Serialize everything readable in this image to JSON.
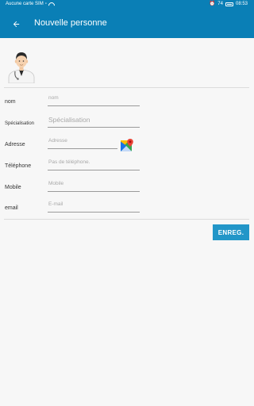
{
  "status_bar": {
    "carrier": "Aucune carte SIM",
    "battery": "74",
    "time": "08:53"
  },
  "app_bar": {
    "title": "Nouvelle personne",
    "back_icon": "arrow-left-icon"
  },
  "avatar_icon": "doctor-avatar-icon",
  "form": {
    "fields": [
      {
        "label": "nom",
        "placeholder": "nom",
        "value": ""
      },
      {
        "label": "Spécialisation",
        "placeholder": "Spécialisation",
        "value": ""
      },
      {
        "label": "Adresse",
        "placeholder": "Adresse",
        "value": ""
      },
      {
        "label": "Téléphone",
        "placeholder": "Pas de téléphone.",
        "value": ""
      },
      {
        "label": "Mobile",
        "placeholder": "Mobile",
        "value": ""
      },
      {
        "label": "email",
        "placeholder": "E-mail",
        "value": ""
      }
    ],
    "maps_icon": "google-maps-icon"
  },
  "save_label": "ENREG.",
  "colors": {
    "primary": "#0a7fb6",
    "button": "#2296c8",
    "background": "#f7f7f7"
  }
}
